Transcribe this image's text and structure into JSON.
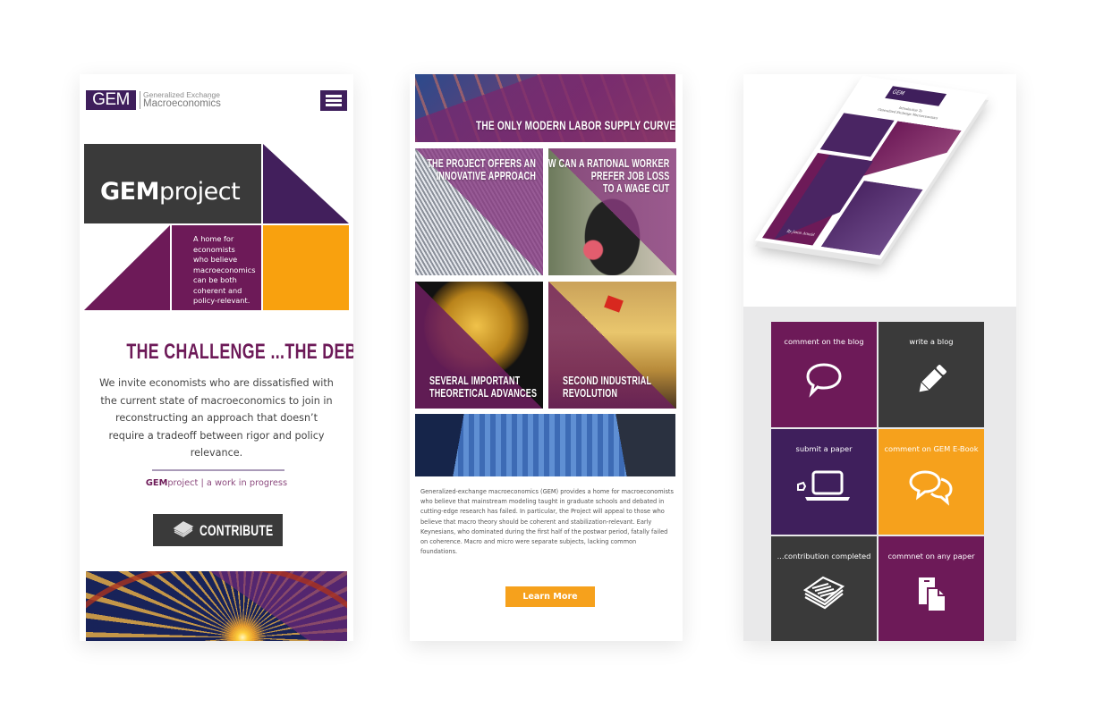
{
  "panel_mobile_home": {
    "logo": {
      "mark": "GEM",
      "line1": "Generalized Exchange",
      "line2": "Macroeconomics"
    },
    "menu_icon": "hamburger-menu-icon",
    "hero": {
      "title_bold": "GEM",
      "title_light": "project",
      "tagline_lines": [
        "A home for",
        "economists",
        "who believe",
        "macroeconomics",
        "can be both",
        "coherent and",
        "policy-relevant."
      ]
    },
    "challenge_heading": "THE CHALLENGE ...THE DEBATE.",
    "intro_text": "We invite economists who are dissatisfied with the current state of macroeconomics to join in reconstructing an approach that doesn’t require a tradeoff between rigor and policy relevance.",
    "footer_tag": {
      "bold": "GEM",
      "rest": "project | a work in progress"
    },
    "contribute_button": {
      "label": "CONTRIBUTE",
      "icon": "paper-stack-icon"
    }
  },
  "panel_mobile_content": {
    "tiles": [
      {
        "caption": "THE ONLY MODERN LABOR SUPPLY CURVE"
      },
      {
        "caption_lines": [
          "THE PROJECT OFFERS AN",
          "INNOVATIVE APPROACH"
        ]
      },
      {
        "caption_lines": [
          "HOW CAN A RATIONAL WORKER",
          "PREFER JOB LOSS",
          "TO A WAGE CUT"
        ]
      },
      {
        "caption_lines": [
          "SEVERAL IMPORTANT",
          "THEORETICAL ADVANCES"
        ]
      },
      {
        "caption_lines": [
          "SECOND INDUSTRIAL",
          "REVOLUTION"
        ]
      }
    ],
    "description": "Generalized-exchange macroeconomics (GEM) provides a home for macroeconomists who believe that mainstream modeling taught in graduate schools and debated in cutting-edge research has failed. In particular, the Project will appeal to those who believe that macro theory should be coherent and stabilization-relevant.  Early Keynesians, who dominated during the first half of the postwar period, fatally failed on coherence. Macro and micro were separate subjects, lacking common foundations.",
    "learn_more_label": "Learn More"
  },
  "panel_mobile_ebook": {
    "book": {
      "logo": "GEM",
      "title_lines": [
        "Introduction To",
        "Generalized Exchange Macroeconomics"
      ],
      "author": "By Jason Arnold"
    },
    "actions": [
      {
        "label": "comment on the blog",
        "icon": "speech-bubble-icon",
        "color": "#6d1a58"
      },
      {
        "label": "write a blog",
        "icon": "pencil-icon",
        "color": "#3a3a3a"
      },
      {
        "label": "submit a paper",
        "icon": "laptop-pointer-icon",
        "color": "#3f1f5c"
      },
      {
        "label": "comment on GEM E-Book",
        "icon": "chat-bubbles-icon",
        "color": "#f6a11c"
      },
      {
        "label": "...contribution completed",
        "icon": "paper-stack-icon",
        "color": "#3a3a3a"
      },
      {
        "label": "commnet on any paper",
        "icon": "documents-icon",
        "color": "#6d1a58"
      }
    ]
  },
  "colors": {
    "brand_purple": "#3f1f5c",
    "brand_magenta": "#6d1a58",
    "accent_orange": "#f6a11c",
    "charcoal": "#3a3a3a"
  }
}
